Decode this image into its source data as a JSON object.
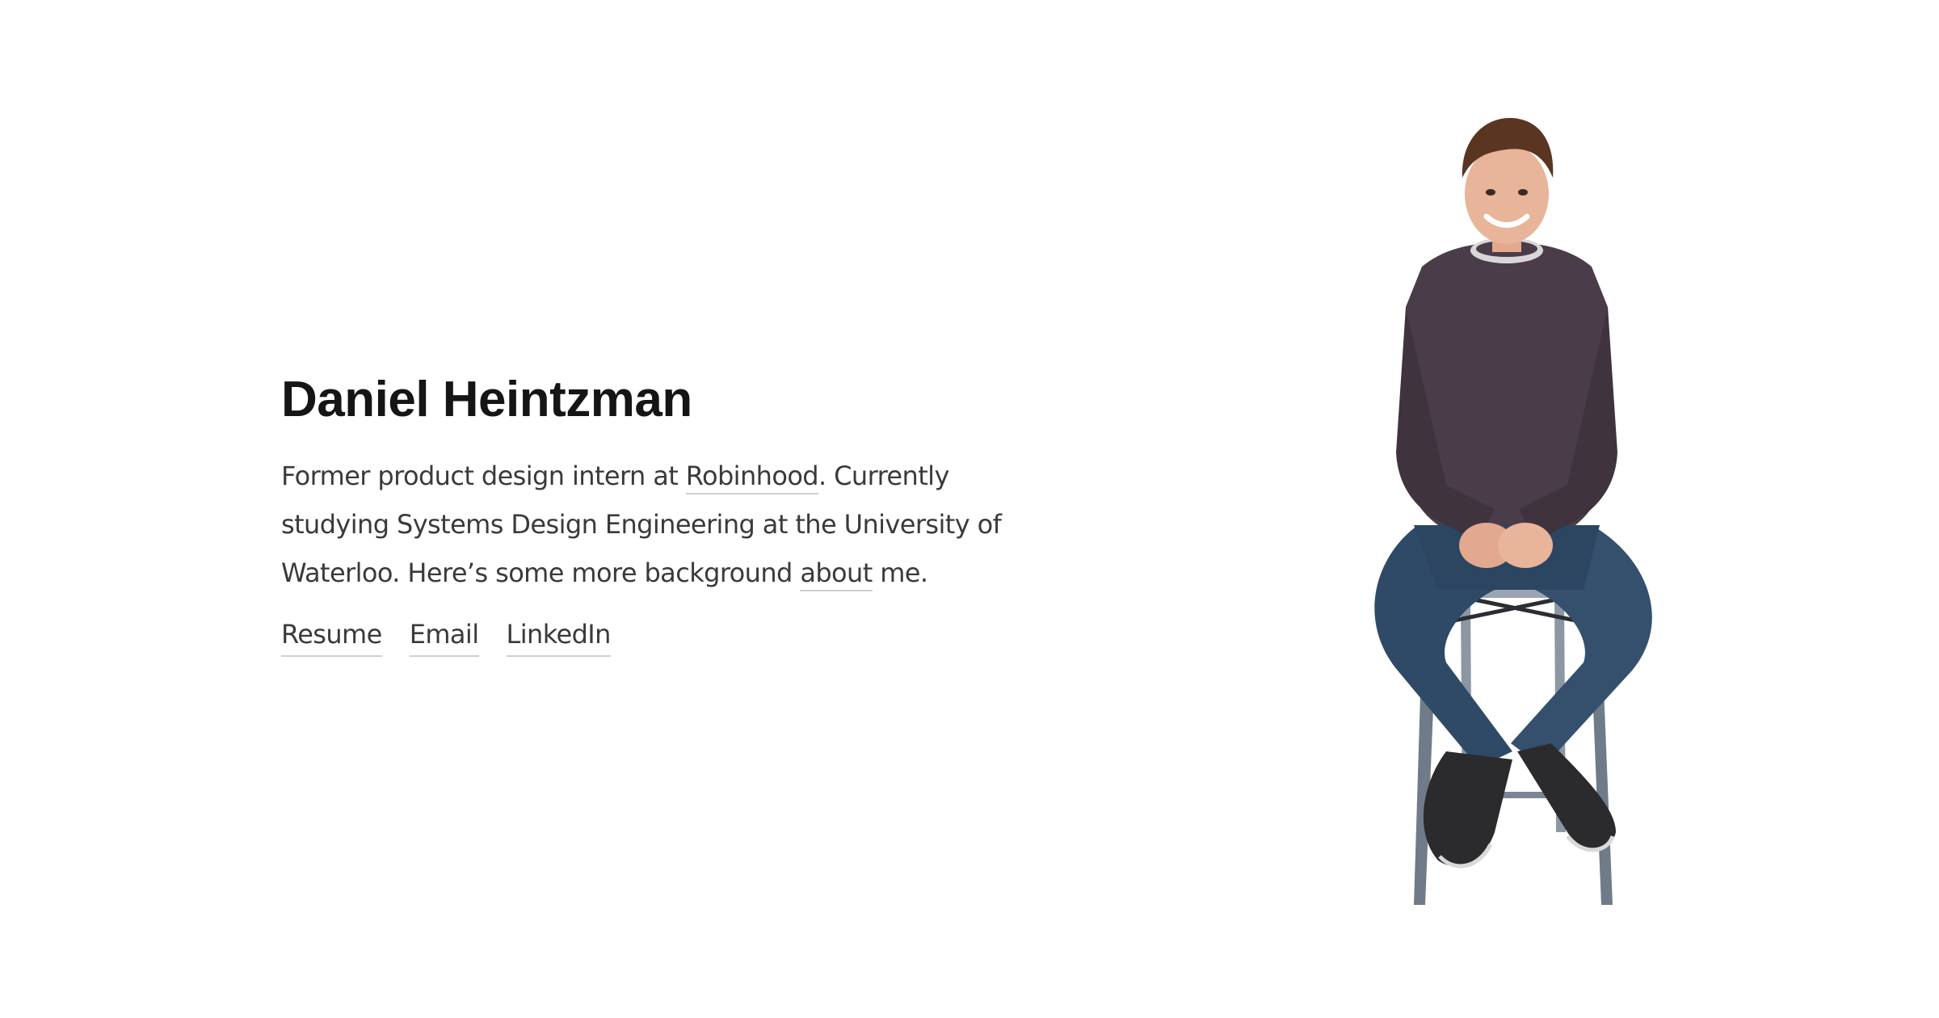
{
  "hero": {
    "name": "Daniel Heintzman",
    "bio": {
      "part1": "Former product design intern at ",
      "company_link": "Robinhood",
      "part2": ". Currently studying Systems Design Engineering at the University of Waterloo. Here’s some more background ",
      "about_link": "about",
      "part3": " me."
    },
    "links": [
      "Resume",
      "Email",
      "LinkedIn"
    ]
  },
  "portrait": {
    "icon": "person-on-stool-photo",
    "colors": {
      "sweater": "#4a3c48",
      "jeans": "#2f4a66",
      "stool": "#7f8b99",
      "skin": "#e8b49a",
      "hair": "#5a3522",
      "shoes": "#2b2b2e"
    }
  }
}
